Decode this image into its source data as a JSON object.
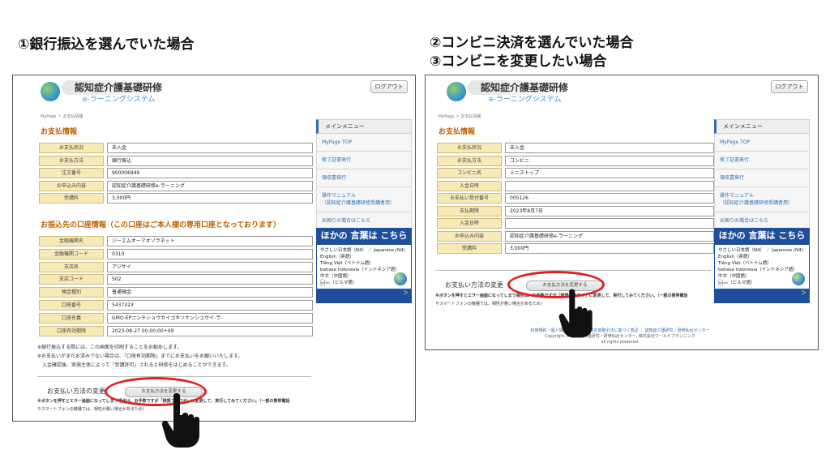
{
  "headings": {
    "left": "①銀行振込を選んでいた場合",
    "right_1": "②コンビニ決済を選んでいた場合",
    "right_2": "③コンビニを変更したい場合"
  },
  "common": {
    "site_title": "認知症介護基礎研修",
    "site_sub": "e-ラーニングシステム",
    "logout": "ログアウト",
    "breadcrumb": "MyPage ＞ お支払情報",
    "section_payment": "お支払情報",
    "menu": {
      "head": "メインメニュー",
      "items": [
        "MyPage TOP",
        "修了証書発行",
        "領収書発行",
        "操作マニュアル\n（認知症介護基礎研修受講者用）",
        "お困りの場合はこちら"
      ]
    },
    "banner": {
      "title": "ほかの 言葉は こちら",
      "lines": [
        "やさしい日本語（N4） ／ Japanese (N4)",
        "English（英語）",
        "Tiếng Việt（ベトナム語）",
        "bahasa Indonesia（インドネシア語）",
        "中文（中国語）",
        "မြန်မာ（ビルマ語）"
      ],
      "arrow": "＞"
    },
    "pay_change_label": "お支払い方法の変更",
    "pay_change_button": "お支払方法を変更する",
    "note_line1": "※ボタンを押すとエラー画面になってしまう場合は、お手数ですが「推奨ブラウザ」に変更して、実行してみてください。（一部の携帯電話",
    "note_line2": "やスマートフォンの機種では、相性が悪い場合があるため）"
  },
  "left_panel": {
    "rows": [
      {
        "label": "お支払状況",
        "value": "未入金"
      },
      {
        "label": "お支払方法",
        "value": "銀行振込"
      },
      {
        "label": "注文番号",
        "value": "900006949"
      },
      {
        "label": "お申込み内容",
        "value": "認知症介護基礎研修e-ラーニング"
      },
      {
        "label": "受講料",
        "value": "3,000円"
      }
    ],
    "section_account": "お振込先の口座情報（この口座はご本人様の専用口座となっております）",
    "account_rows": [
      {
        "label": "金融機関名",
        "value": "ジーエムオーアオゾラネット"
      },
      {
        "label": "金融機関コード",
        "value": "0310"
      },
      {
        "label": "支店名",
        "value": "アジサイ"
      },
      {
        "label": "支店コード",
        "value": "502"
      },
      {
        "label": "預金種別",
        "value": "普通預金"
      },
      {
        "label": "口座番号",
        "value": "5437323"
      },
      {
        "label": "口座名義",
        "value": "GMO-EPニンチショウカイゴキソケンシュウイ-ラ-"
      },
      {
        "label": "口座有効期限",
        "value": "2023-08-27 00:00:00+09"
      }
    ],
    "notes": [
      "※銀行振込する際には、この画面を印刷することをお勧めします。",
      "※お支払いがまだお済みでない場合は、「口座有効期限」までにお支払いをお願いいたします。",
      "　入金確認後、実施主体によって「受講許可」されると研修をはじめることができます。"
    ]
  },
  "right_panel": {
    "rows": [
      {
        "label": "お支払状況",
        "value": "未入金"
      },
      {
        "label": "お支払方法",
        "value": "コンビニ"
      },
      {
        "label": "コンビニ名",
        "value": "ミニストップ"
      },
      {
        "label": "入金日時",
        "value": ""
      },
      {
        "label": "お支払い受付番号",
        "value": "005126"
      },
      {
        "label": "支払期限",
        "value": "2023年8月7日"
      },
      {
        "label": "入金日時",
        "value": ""
      },
      {
        "label": "お申込み内容",
        "value": "認知症介護基礎研修e-ラーニング"
      },
      {
        "label": "受講料",
        "value": "3,000円"
      }
    ],
    "footer_line1": "利用規約・個人情報保護方針 ｜ 特定商取引法に基づく表記 ｜ 認知症介護研究・研修仙台センター",
    "footer_line2": "Copyright © 認知症介護研究・研修仙台センター, 株式会社ワールドプランニング",
    "footer_line3": "all rights reserved."
  }
}
